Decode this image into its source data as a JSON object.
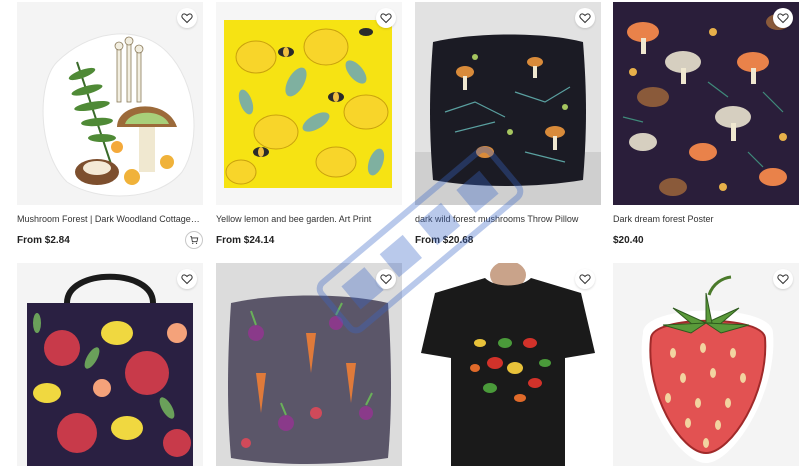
{
  "products": [
    {
      "title": "Mushroom Forest | Dark Woodland Cottagecore Mushroom Sticker",
      "price": "From $2.84",
      "image_icon": "sticker-mushroom-icon",
      "has_cart": true
    },
    {
      "title": "Yellow lemon and bee garden. Art Print",
      "price": "From $24.14",
      "image_icon": "art-print-lemon-bee-icon",
      "has_cart": false
    },
    {
      "title": "dark wild forest mushrooms Throw Pillow",
      "price": "From $20.68",
      "image_icon": "throw-pillow-mushroom-icon",
      "has_cart": false
    },
    {
      "title": "Dark dream forest Poster",
      "price": "$20.40",
      "image_icon": "poster-forest-icon",
      "has_cart": false
    },
    {
      "title": "",
      "price": "",
      "image_icon": "tote-bag-pomegranate-icon",
      "has_cart": false
    },
    {
      "title": "",
      "price": "",
      "image_icon": "throw-pillow-vegetables-icon",
      "has_cart": false
    },
    {
      "title": "",
      "price": "",
      "image_icon": "tshirt-peppers-icon",
      "has_cart": false
    },
    {
      "title": "",
      "price": "",
      "image_icon": "sticker-strawberry-icon",
      "has_cart": false
    }
  ],
  "colors": {
    "lemon_bg": "#f6e313",
    "dark_forest": "#2a1e3a",
    "pillow_dark": "#1b1b24",
    "strawberry": "#e25252",
    "tote_dark": "#2a2042",
    "veg_pillow": "#5b5669"
  }
}
